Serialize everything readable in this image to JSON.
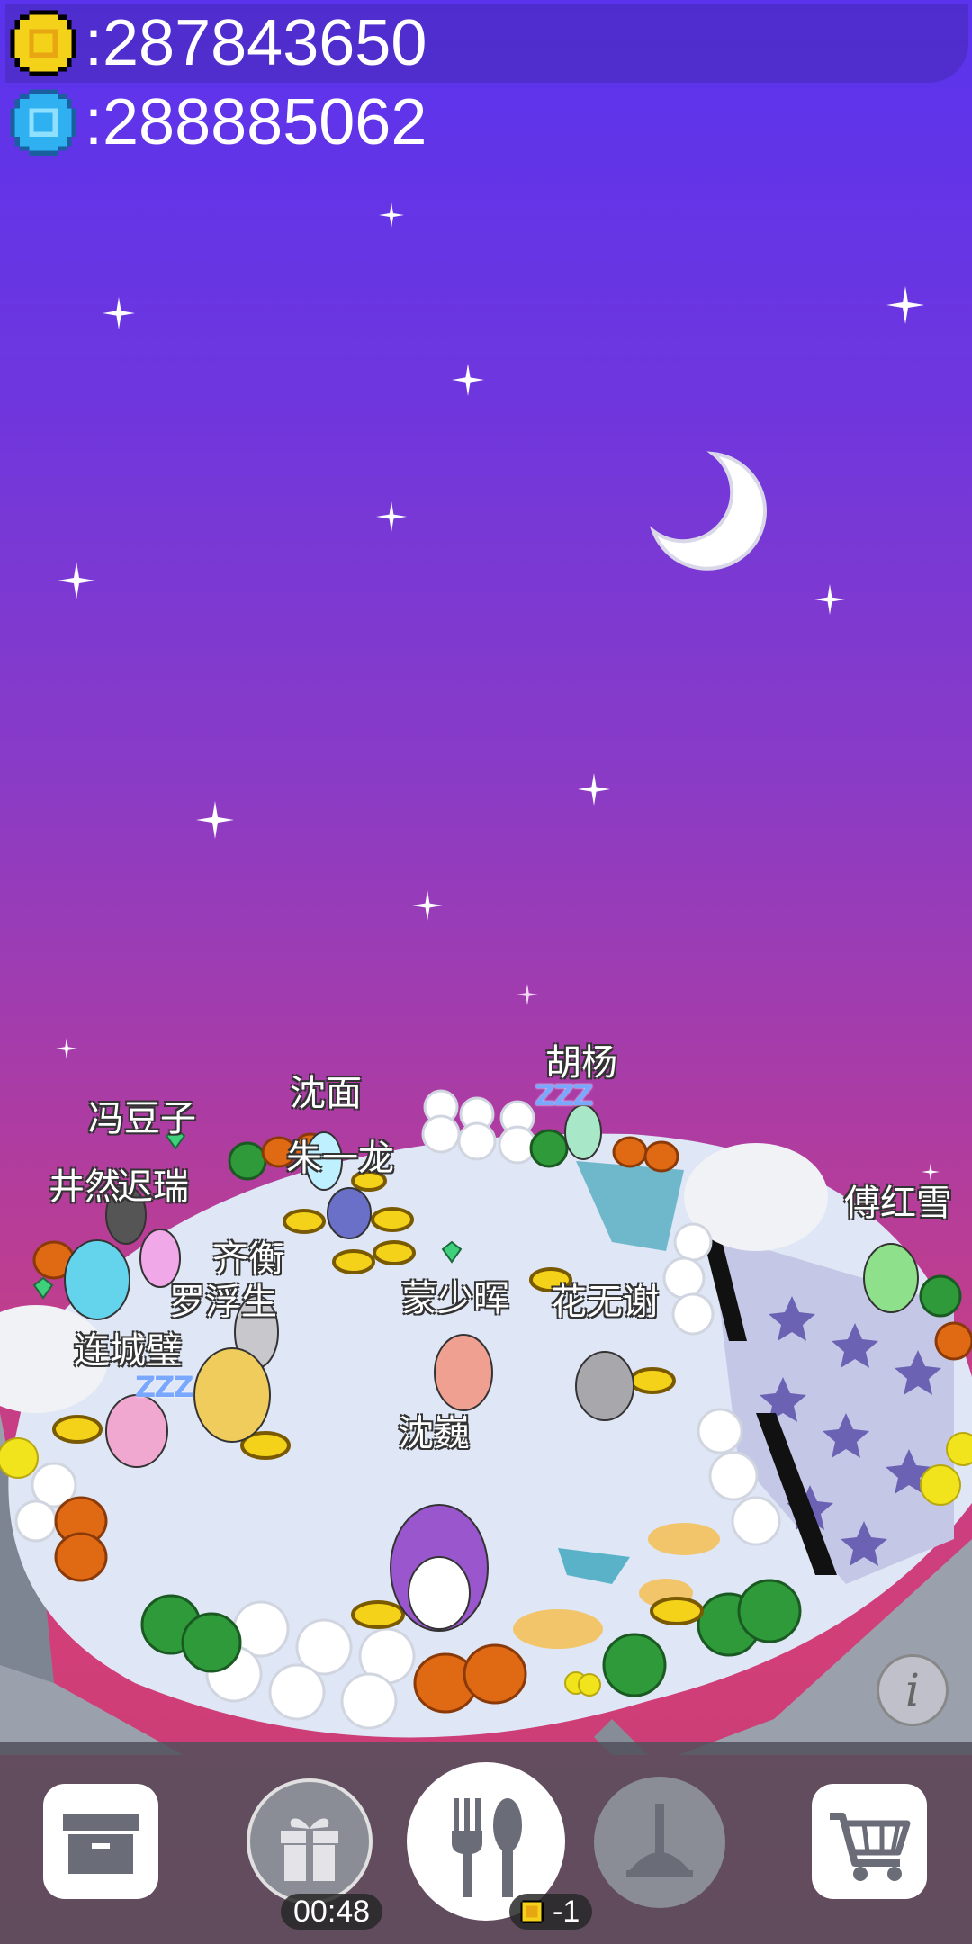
{
  "hud": {
    "coins": ":287843650",
    "gems": ":288885062"
  },
  "characters": [
    {
      "name": "胡杨"
    },
    {
      "name": "沈面"
    },
    {
      "name": "冯豆子"
    },
    {
      "name": "朱一龙"
    },
    {
      "name": "井然"
    },
    {
      "name": "迟瑞"
    },
    {
      "name": "傅红雪"
    },
    {
      "name": "齐衡"
    },
    {
      "name": "罗浮生"
    },
    {
      "name": "蒙少晖"
    },
    {
      "name": "花无谢"
    },
    {
      "name": "连城璧"
    },
    {
      "name": "沈巍"
    }
  ],
  "sleep_marks": [
    "ZZZ",
    "ZZZ"
  ],
  "toolbar": {
    "storage_icon": "box-icon",
    "gift_icon": "gift-icon",
    "gift_timer": "00:48",
    "feed_icon": "fork-spoon-icon",
    "feed_cost": "-1",
    "clean_icon": "plunger-icon",
    "shop_icon": "cart-icon",
    "info_label": "i"
  },
  "colors": {
    "coin": "#f5d21a",
    "gem": "#2fb0f0",
    "sky_top": "#5a33ee",
    "sky_bottom": "#d23f78"
  }
}
